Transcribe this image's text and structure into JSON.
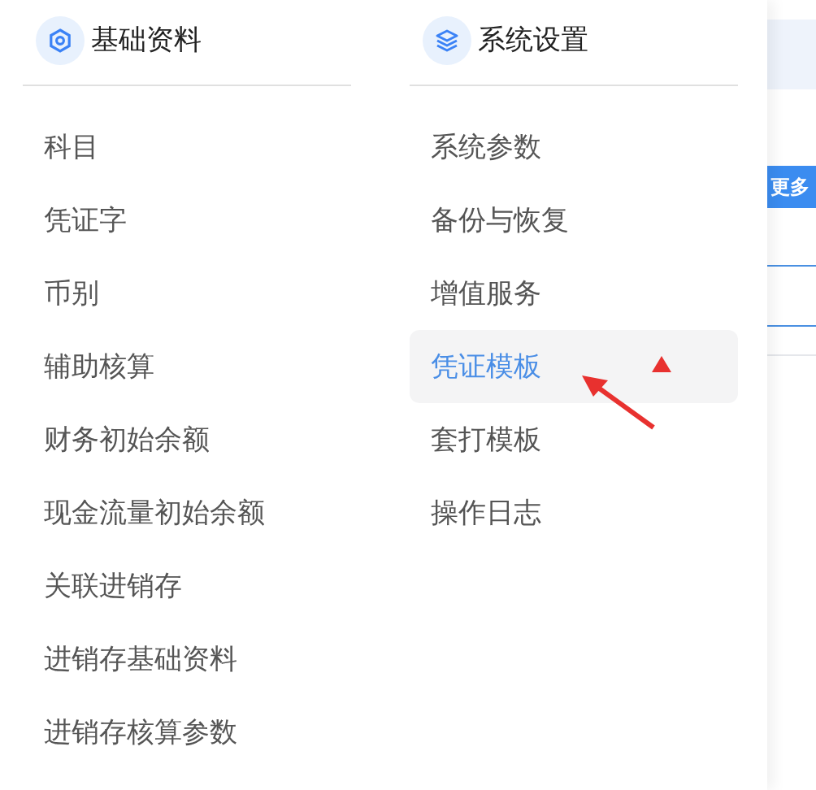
{
  "columns": [
    {
      "title": "基础资料",
      "kind": "hexagon",
      "items": [
        {
          "label": "科目",
          "selected": false
        },
        {
          "label": "凭证字",
          "selected": false
        },
        {
          "label": "币别",
          "selected": false
        },
        {
          "label": "辅助核算",
          "selected": false
        },
        {
          "label": "财务初始余额",
          "selected": false
        },
        {
          "label": "现金流量初始余额",
          "selected": false
        },
        {
          "label": "关联进销存",
          "selected": false
        },
        {
          "label": "进销存基础资料",
          "selected": false
        },
        {
          "label": "进销存核算参数",
          "selected": false
        }
      ]
    },
    {
      "title": "系统设置",
      "kind": "layers",
      "items": [
        {
          "label": "系统参数",
          "selected": false
        },
        {
          "label": "备份与恢复",
          "selected": false
        },
        {
          "label": "增值服务",
          "selected": false
        },
        {
          "label": "凭证模板",
          "selected": true
        },
        {
          "label": "套打模板",
          "selected": false
        },
        {
          "label": "操作日志",
          "selected": false
        }
      ]
    }
  ],
  "side_panel": {
    "button": "更多"
  }
}
